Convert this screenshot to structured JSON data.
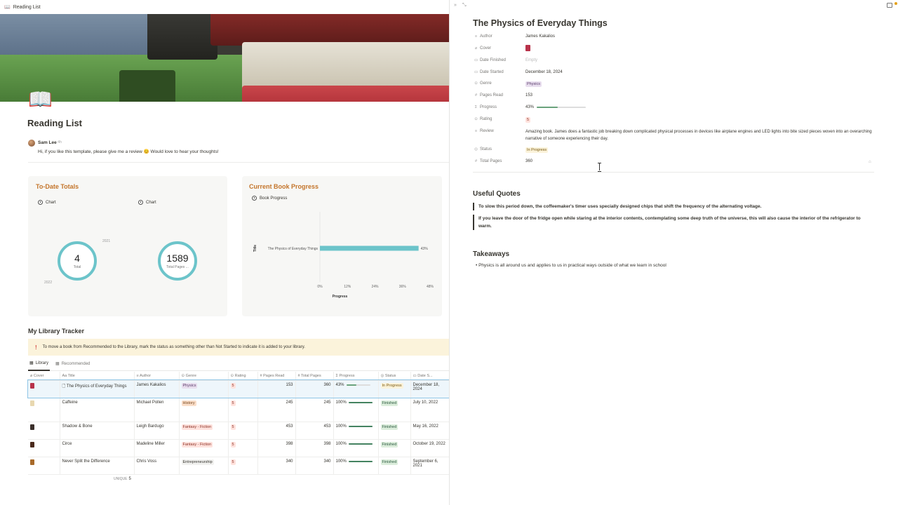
{
  "window": {
    "tab_title": "Reading List"
  },
  "page": {
    "title": "Reading List",
    "comment": {
      "author": "Sam Lee",
      "time": "4h",
      "text": "Hi, if you like this template, please give me a review 😊 Would love to hear your thoughts!"
    }
  },
  "totals_card": {
    "title": "To-Date Totals",
    "charts": [
      {
        "label": "Chart",
        "value": "4",
        "sub": "Total",
        "ticks": [
          "2021",
          "2022"
        ]
      },
      {
        "label": "Chart",
        "value": "1589",
        "sub": "Total Pages ..."
      }
    ]
  },
  "progress_card": {
    "title": "Current Book Progress",
    "chart_label": "Book Progress"
  },
  "chart_data": {
    "type": "bar",
    "orientation": "horizontal",
    "categories": [
      "The Physics of Everyday Things"
    ],
    "values": [
      43
    ],
    "data_labels": [
      "43%"
    ],
    "xlabel": "Progress",
    "ylabel": "Title",
    "xticks": [
      "0%",
      "12%",
      "24%",
      "36%",
      "48%"
    ],
    "xlim": [
      0,
      48
    ],
    "color": "#6cc4ca"
  },
  "tracker": {
    "title": "My Library Tracker",
    "callout": "To move a book from Recommended to the Library, mark the status as something other than Not Started to indicate it is added to your library.",
    "tabs": [
      "Library",
      "Recommended"
    ],
    "columns": [
      "Cover",
      "Title",
      "Author",
      "Genre",
      "Rating",
      "Pages Read",
      "Total Pages",
      "Progress",
      "Status",
      "Date S..."
    ],
    "rows": [
      {
        "title": "The Physics of Everyday Things",
        "author": "James Kakalios",
        "genre": "Physics",
        "rating": "5",
        "pages_read": "153",
        "total_pages": "360",
        "progress": "43%",
        "progress_value": 43,
        "status": "In Progress",
        "date": "December 18, 2024",
        "cover_color": "#b8324a"
      },
      {
        "title": "Caffeine",
        "author": "Michael Pollen",
        "genre": "History",
        "rating": "5",
        "pages_read": "245",
        "total_pages": "245",
        "progress": "100%",
        "progress_value": 100,
        "status": "Finished",
        "date": "July 10, 2022",
        "cover_color": "#e8d8b0"
      },
      {
        "title": "Shadow & Bone",
        "author": "Leigh Bardugo",
        "genre": "Fantasy - Fiction",
        "rating": "5",
        "pages_read": "453",
        "total_pages": "453",
        "progress": "100%",
        "progress_value": 100,
        "status": "Finished",
        "date": "May 16, 2022",
        "cover_color": "#3a2f2a"
      },
      {
        "title": "Circe",
        "author": "Madeline Miller",
        "genre": "Fantasy - Fiction",
        "rating": "5",
        "pages_read": "398",
        "total_pages": "398",
        "progress": "100%",
        "progress_value": 100,
        "status": "Finished",
        "date": "October 19, 2022",
        "cover_color": "#4a2a1c"
      },
      {
        "title": "Never Split the Difference",
        "author": "Chris Voss",
        "genre": "Entrepreneurship",
        "rating": "5",
        "pages_read": "340",
        "total_pages": "340",
        "progress": "100%",
        "progress_value": 100,
        "status": "Finished",
        "date": "September 6, 2021",
        "cover_color": "#a86a2a"
      }
    ],
    "footer": {
      "label": "UNIQUE",
      "value": "5"
    }
  },
  "detail": {
    "title": "The Physics of Everyday Things",
    "props": [
      {
        "label": "Author",
        "value": "James Kakalios",
        "icon": "text-icon"
      },
      {
        "label": "Cover",
        "value": "",
        "icon": "paperclip-icon"
      },
      {
        "label": "Date Finished",
        "value": "Empty",
        "icon": "calendar-icon"
      },
      {
        "label": "Date Started",
        "value": "December 18, 2024",
        "icon": "calendar-icon"
      },
      {
        "label": "Genre",
        "value": "Physics",
        "icon": "select-icon"
      },
      {
        "label": "Pages Read",
        "value": "153",
        "icon": "number-icon"
      },
      {
        "label": "Progress",
        "value": "43%",
        "icon": "sigma-icon",
        "progress_value": 43
      },
      {
        "label": "Rating",
        "value": "5",
        "icon": "select-icon"
      },
      {
        "label": "Review",
        "value": "Amazing book. James does a fantastic job breaking down complicated physical processes in devices like airplane engines and LED lights into bite sized pieces woven into an overarching narrative of someone experiencing their day.",
        "icon": "text-icon"
      },
      {
        "label": "Status",
        "value": "In Progress",
        "icon": "status-icon"
      },
      {
        "label": "Total Pages",
        "value": "360",
        "icon": "number-icon"
      }
    ],
    "quotes_heading": "Useful Quotes",
    "quotes": [
      "To slow this period down, the coffeemaker's timer uses specially designed chips that shift the frequency of the alternating voltage.",
      "If you leave the door of the fridge open while staring at the interior contents, contemplating some deep truth of the universe, this will also cause the interior of the refrigerator to warm."
    ],
    "takeaways_heading": "Takeaways",
    "takeaways": [
      "Physics is all around us and applies to us in practical ways outside of what we learn in school"
    ]
  },
  "colors": {
    "accent_orange": "#c4752b",
    "teal": "#6cc4ca",
    "progress_green": "#448361"
  }
}
